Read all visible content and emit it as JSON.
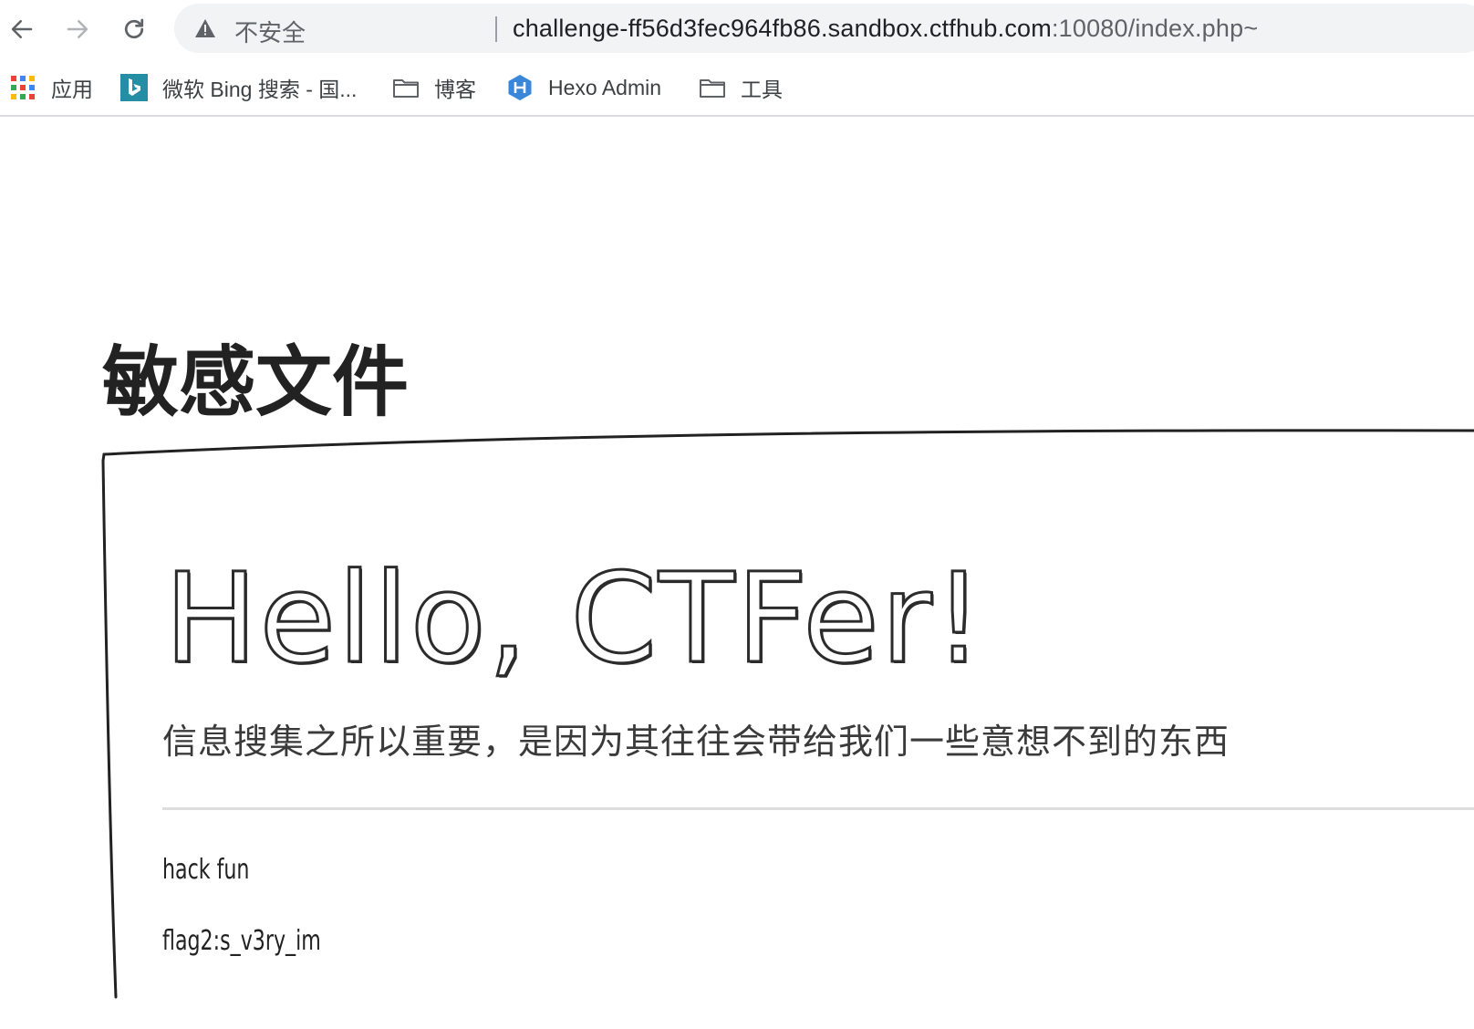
{
  "browser": {
    "security_label": "不安全",
    "url_main": "challenge-ff56d3fec964fb86.sandbox.ctfhub.com",
    "url_rest": ":10080/index.php~"
  },
  "bookmarks": [
    {
      "label": "应用",
      "icon": "apps-grid-icon"
    },
    {
      "label": "微软 Bing 搜索 - 国...",
      "icon": "bing-icon"
    },
    {
      "label": "博客",
      "icon": "folder-icon"
    },
    {
      "label": "Hexo Admin",
      "icon": "hexo-icon"
    },
    {
      "label": "工具",
      "icon": "folder-icon"
    }
  ],
  "page": {
    "title": "敏感文件",
    "hero_heading": "Hello, CTFer!",
    "lead": "信息搜集之所以重要，是因为其往往会带给我们一些意想不到的东西",
    "paragraphs": [
      "hack fun",
      "flag2:s_v3ry_im"
    ]
  },
  "colors": {
    "omnibox_bg": "#f1f3f4",
    "divider": "#dedede",
    "text_dark": "#222222"
  }
}
